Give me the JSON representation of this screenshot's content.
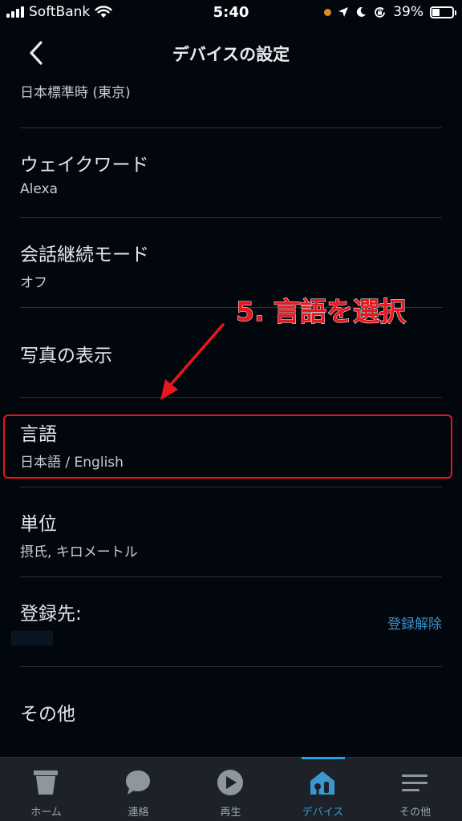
{
  "status_bar": {
    "carrier": "SoftBank",
    "time": "5:40",
    "battery": "39%",
    "battery_level": 0.39
  },
  "header": {
    "title": "デバイスの設定"
  },
  "settings": [
    {
      "title": "",
      "subtitle": "日本標準時 (東京)"
    },
    {
      "title": "ウェイクワード",
      "subtitle": "Alexa"
    },
    {
      "title": "会話継続モード",
      "subtitle": "オフ"
    },
    {
      "title": "写真の表示",
      "subtitle": ""
    },
    {
      "title": "言語",
      "subtitle": "日本語 / English"
    },
    {
      "title": "単位",
      "subtitle": "摂氏, キロメートル"
    },
    {
      "title": "登録先:",
      "subtitle": "",
      "action": "登録解除"
    },
    {
      "title": "その他",
      "subtitle": ""
    }
  ],
  "annotation": {
    "text": "5. 言語を選択",
    "color": "#e9161d"
  },
  "tabs": [
    {
      "label": "ホーム",
      "icon": "home-icon"
    },
    {
      "label": "連絡",
      "icon": "chat-bubble-icon"
    },
    {
      "label": "再生",
      "icon": "play-icon"
    },
    {
      "label": "デバイス",
      "icon": "devices-icon",
      "active": true
    },
    {
      "label": "その他",
      "icon": "menu-lines-icon"
    }
  ],
  "colors": {
    "accent": "#27a3e0",
    "link": "#3d8fc6",
    "highlight": "#e8141b",
    "background": "#02070e"
  }
}
